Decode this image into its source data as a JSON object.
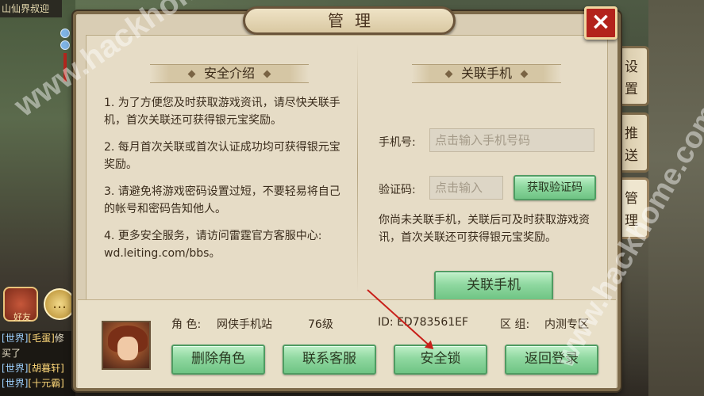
{
  "top_left": {
    "text": "山仙界叔迎"
  },
  "dialog": {
    "title": "管理",
    "close_icon": "×"
  },
  "intro": {
    "header": "安全介绍",
    "items": [
      "1. 为了方便您及时获取游戏资讯，请尽快关联手机，首次关联还可获得银元宝奖励。",
      "2. 每月首次关联或首次认证成功均可获得银元宝奖励。",
      "3. 请避免将游戏密码设置过短，不要轻易将自己的帐号和密码告知他人。",
      "4. 更多安全服务，请访问雷霆官方客服中心: wd.leiting.com/bbs。"
    ]
  },
  "bind": {
    "header": "关联手机",
    "phone_label": "手机号:",
    "phone_placeholder": "点击输入手机号码",
    "code_label": "验证码:",
    "code_placeholder": "点击输入",
    "get_code_button": "获取验证码",
    "description": "你尚未关联手机，关联后可及时获取游戏资讯，首次关联还可获得银元宝奖励。",
    "bind_button": "关联手机"
  },
  "player": {
    "role_label": "角 色:",
    "role_name": "网侠手机站",
    "level": "76级",
    "id": "ID: ED783561EF",
    "zone_label": "区 组:",
    "zone": "内测专区"
  },
  "bottom_buttons": {
    "delete_role": "删除角色",
    "contact_support": "联系客服",
    "security_lock": "安全锁",
    "back_to_login": "返回登录"
  },
  "side_tabs": [
    {
      "label_1": "设",
      "label_2": "置"
    },
    {
      "label_1": "推",
      "label_2": "送"
    },
    {
      "label_1": "管",
      "label_2": "理"
    }
  ],
  "left_panel": {
    "friend_label": "好友",
    "chat": [
      {
        "tag": "世界",
        "name": "[毛蛋]",
        "text": "修"
      },
      {
        "tag": "",
        "name": "",
        "text": "买了"
      },
      {
        "tag": "世界",
        "name": "[胡暮轩]",
        "text": ""
      },
      {
        "tag": "世界",
        "name": "[十元霸]",
        "text": ""
      }
    ]
  },
  "watermarks": [
    "www.hackhome.com",
    "www.hackhome.com"
  ],
  "colors": {
    "accent_red": "#b3231c",
    "button_green": "#8fd8a0",
    "panel_bg": "#e6dcc6"
  }
}
